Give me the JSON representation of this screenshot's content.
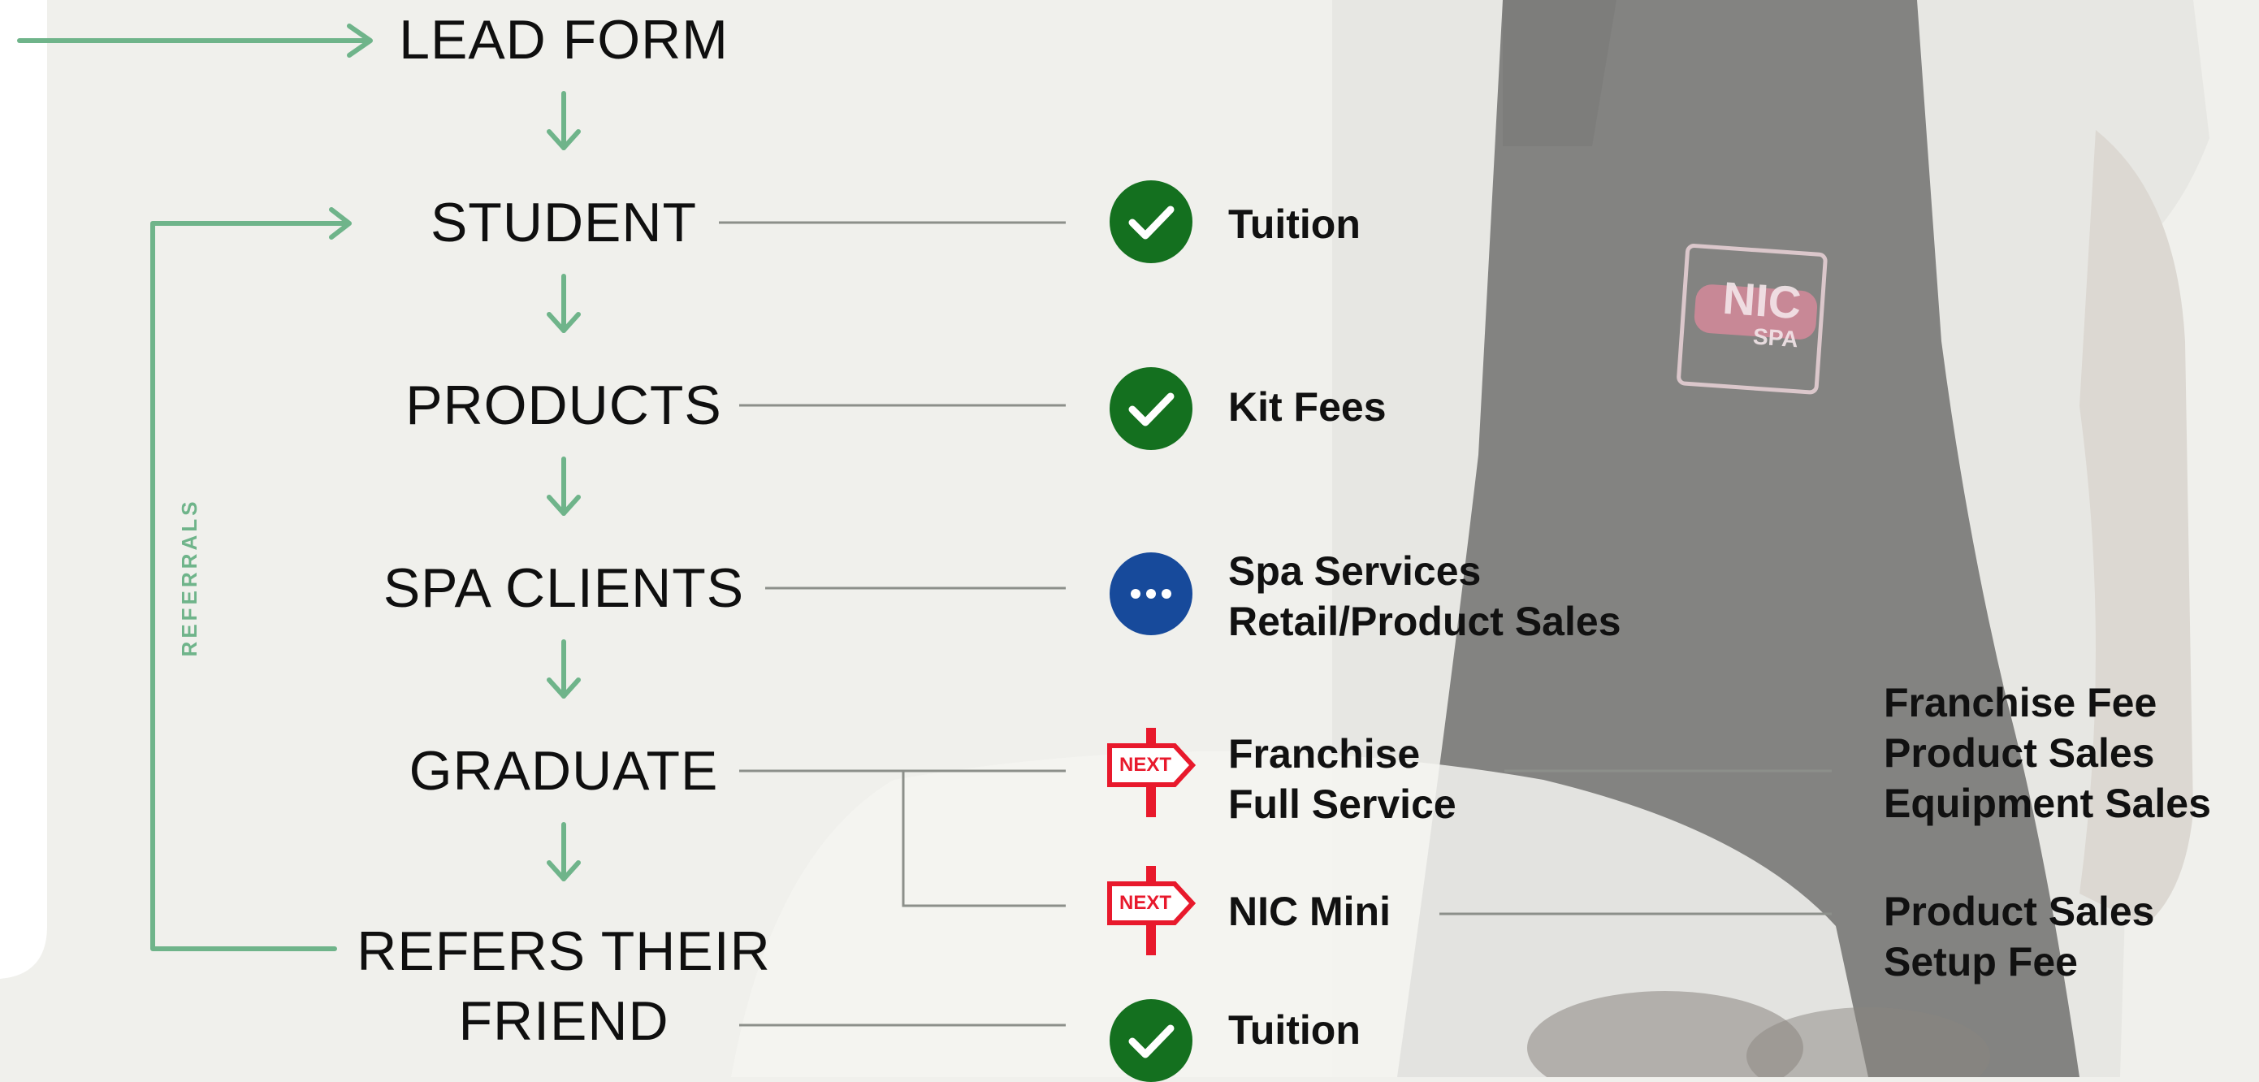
{
  "colors": {
    "arrow_green": "#6fb48a",
    "connector_gray": "#8c8f8a",
    "check_green": "#14701f",
    "pending_blue": "#174a9b",
    "next_red": "#e8192c",
    "apron_dark": "#4a4a4a"
  },
  "background": {
    "logo_line1": "NIC",
    "logo_line2": "SPA"
  },
  "side_label": "REFERRALS",
  "stages": [
    {
      "id": "lead-form",
      "lines": [
        "LEAD FORM"
      ]
    },
    {
      "id": "student",
      "lines": [
        "STUDENT"
      ]
    },
    {
      "id": "products",
      "lines": [
        "PRODUCTS"
      ]
    },
    {
      "id": "spa-clients",
      "lines": [
        "SPA CLIENTS"
      ]
    },
    {
      "id": "graduate",
      "lines": [
        "GRADUATE"
      ]
    },
    {
      "id": "refers-their-friend",
      "lines": [
        "REFERS THEIR",
        "FRIEND"
      ]
    }
  ],
  "revenue": [
    {
      "stage": "student",
      "status_icon": "check-circle-icon",
      "lines": [
        "Tuition"
      ]
    },
    {
      "stage": "products",
      "status_icon": "check-circle-icon",
      "lines": [
        "Kit Fees"
      ]
    },
    {
      "stage": "spa-clients",
      "status_icon": "ellipsis-circle-icon",
      "lines": [
        "Spa Services",
        "Retail/Product Sales"
      ]
    },
    {
      "stage": "graduate",
      "status_icon": "next-sign-icon",
      "sign_text": "NEXT",
      "lines": [
        "Franchise",
        "Full Service"
      ],
      "details": [
        "Franchise Fee",
        "Product Sales",
        "Equipment Sales"
      ]
    },
    {
      "stage": "graduate",
      "status_icon": "next-sign-icon",
      "sign_text": "NEXT",
      "lines": [
        "NIC Mini"
      ],
      "details": [
        "Product Sales",
        "Setup Fee"
      ]
    },
    {
      "stage": "refers-their-friend",
      "status_icon": "check-circle-icon",
      "lines": [
        "Tuition"
      ]
    }
  ]
}
